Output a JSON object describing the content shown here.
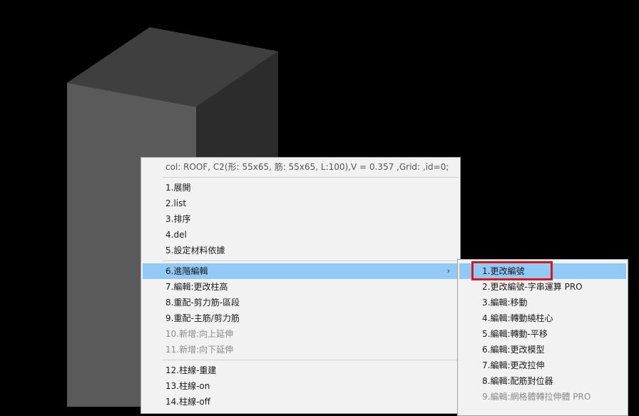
{
  "scene": {
    "background": "#000000",
    "column_colors": {
      "top": "#3f3f3f",
      "front": "#5a5a5a",
      "side": "#2c2c2c"
    }
  },
  "context_menu": {
    "header": "col: ROOF, C2(形: 55x65, 筋: 55x65, L:100),V = 0.357 ,Grid: ,id=0;",
    "group1": [
      "1.展開",
      "2.list",
      "3.排序",
      "4.del",
      "5.設定材料依據"
    ],
    "group2": [
      {
        "label": "6.進階編輯",
        "highlighted": true,
        "has_submenu": true
      },
      {
        "label": "7.編輯:更改柱高"
      },
      {
        "label": "8.重配-剪力筋-區段"
      },
      {
        "label": "9.重配-主筋/剪力筋"
      },
      {
        "label": "10.新增:向上延伸",
        "disabled": true
      },
      {
        "label": "11.新增:向下延伸",
        "disabled": true
      }
    ],
    "group3": [
      "12.柱線-重建",
      "13.柱線-on",
      "14.柱線-off"
    ],
    "submenu_arrow": "›"
  },
  "submenu": {
    "items": [
      {
        "label": "1.更改編號",
        "highlighted": true
      },
      {
        "label": "2.更改編號-字串運算 PRO"
      },
      {
        "label": "3.編輯:移動"
      },
      {
        "label": "4.編輯:轉動繞柱心"
      },
      {
        "label": "5.編輯:轉動-平移"
      },
      {
        "label": "6.編輯:更改模型"
      },
      {
        "label": "7.編輯:更改拉伸"
      },
      {
        "label": "8.編輯:配筋對位器"
      },
      {
        "label": "9.編輯:網格體轉拉伸體 PRO",
        "disabled": true
      }
    ]
  },
  "colors": {
    "highlight": "#91c9f7",
    "menu_bg": "#f2f2f2",
    "annotation_box": "#e0141e"
  }
}
